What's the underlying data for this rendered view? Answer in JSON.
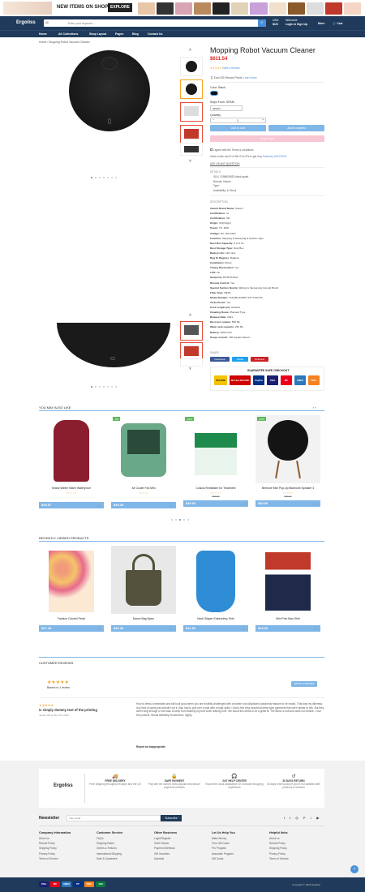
{
  "banner": {
    "headline": "NEW ITEMS ON SHOP",
    "cta": "EXPLORE"
  },
  "header": {
    "logo": "Ergoliss",
    "search_category": "All",
    "search_placeholder": "Enter your keyword ...",
    "currency_label": "USD",
    "currency_value": "$US",
    "account_top": "Welcome",
    "account_label": "Login & Sign Up",
    "more_label": "More",
    "cart_label": "Cart"
  },
  "nav": [
    "Home",
    "All Collections",
    "Shop Layout",
    "Pages",
    "Blog",
    "Contact Us"
  ],
  "breadcrumb": [
    "Home",
    "Mopping Robot Vacuum Cleaner"
  ],
  "product": {
    "title": "Mopping Robot Vacuum Cleaner",
    "price": "$611.54",
    "reviews_link": "Write a Review",
    "reward": "Earn 305 Reward Points.",
    "learn_more": "Learn More.",
    "color_label": "Color: Black",
    "ships_label": "Ships From: SPAIN",
    "ships_value": "SPAIN",
    "qty_label": "Quantity",
    "qty_value": "1",
    "add_to_cart": "Add to cart",
    "add_wishlist": "Add to wishlist",
    "buy_now": "Buy it now",
    "terms_text": "I agree with the Terms & conditions",
    "order_note": "Order in the next 3 d 00h 07m 37s to get it by",
    "order_date": "Saturday 16/07/2022",
    "question": "ASK US ANY QUESTION",
    "details_title": "DETAILS",
    "details": [
      "SKU: 3158604633-black-spain",
      "Brands: Xiaomi",
      "Type:",
      "Availability: In Stock"
    ],
    "desc_title": "DESCRIPTION",
    "specs": [
      [
        "Xiaomi Brand Name:",
        "Xiaomi"
      ],
      [
        "Certification:",
        "ce"
      ],
      [
        "Certification:",
        "CE"
      ],
      [
        "Origin:",
        "CN(Origin)"
      ],
      [
        "Power:",
        "Hz: 40W"
      ],
      [
        "Voltage:",
        "DC 100-240V"
      ],
      [
        "Function:",
        "Mopping & Sweeping & Suction Type"
      ],
      [
        "Dust Box Capacity:",
        "0.2~0.5 L"
      ],
      [
        "Dust Storage Type:",
        "Dust Box"
      ],
      [
        "Battery Life:",
        "120 mins"
      ],
      [
        "Bag Or Bagless:",
        "Bagless"
      ],
      [
        "Installation:",
        "Robot"
      ],
      [
        "Timing Reservation:",
        "Yes"
      ],
      [
        "LCD:",
        "No"
      ],
      [
        "Size(mm):",
        "35*35*8.45cm"
      ],
      [
        "Remote Control:",
        "Yes"
      ],
      [
        "Special Suction Nozzle:",
        "Wiping & Vacuuming Ground Brush"
      ],
      [
        "Filter Type:",
        "HEPA"
      ],
      [
        "Model Number:",
        "XIAOMI ROBOT STYTJ02YM"
      ],
      [
        "Turbo Brush:",
        "Yes"
      ],
      [
        "Cord Length (m):",
        "wireless"
      ],
      [
        "Cleaning Route:",
        "Planned Type"
      ],
      [
        "Release Date:",
        "2021"
      ],
      [
        "Dust box volume:",
        "550 ML"
      ],
      [
        "Water tank capacity:",
        "280 ML"
      ],
      [
        "Battery:",
        "3200 mAh"
      ],
      [
        "Scope of work:",
        "150 Square Meters"
      ]
    ],
    "share_title": "SHARE",
    "share": [
      "Facebook",
      "Twitter",
      "Pinterest"
    ],
    "guarantee": "GUARANTEE SAFE CHECKOUT",
    "pay_logos": [
      "SECURE",
      "McAfee SECURE",
      "PayPal",
      "VISA",
      "MC",
      "AMEX",
      "DISC"
    ]
  },
  "also_like": {
    "title": "YOU MAY ALSO LIKE",
    "items": [
      {
        "name": "Brand Winter Warm Waterproof",
        "price": "$40.57",
        "old": ""
      },
      {
        "name": "Air Cooler Fan Mini",
        "price": "$49.29",
        "old": "",
        "badge": "-6%"
      },
      {
        "name": "Cosiclo Revitalizer for Treatment",
        "price": "$40.00",
        "old": "$50.00",
        "badge": "-20%"
      },
      {
        "name": "Bremore Mini Pop-Up Bluetooth Speaker 4",
        "price": "$40.00",
        "old": "$50.00",
        "badge": "-20%"
      }
    ]
  },
  "recent": {
    "title": "RECENTLY VIEWED PRODUCTS",
    "items": [
      {
        "name": "Fashion Colorful Floral",
        "price": "$27.18"
      },
      {
        "name": "Dance Bag Nylon",
        "price": "$30.20"
      },
      {
        "name": "Neck Slipper Embroidery Shirt",
        "price": "$31.52"
      },
      {
        "name": "Mini Polo Man Shirt",
        "price": "$19.09"
      }
    ]
  },
  "reviews": {
    "title": "CUSTOMER REVIEWS",
    "based": "Based on 1 review",
    "write": "WRITE A REVIEW",
    "review_title": "is simply dummy text of the printing",
    "review_author": "Jeneth Hill on Nov 01, 2021",
    "review_body": "How to dress comfortably and still look good when you are mobility challenged with a broken foot (displaced calcaneus fracture to be exact). That was my dilemma. Any kind of pants just wouldn't cut it. Also had to pull over a cast with a huge splint. I had a few long tunic/midi-dress type garments that were similar to this. But they aren't long enough or the back to keep from flashing my butt when leaning over. We found this dress to be a great fit. The fabric is soft and does not wrinkle. I love the pockets. Would definitely recommend, highly.",
    "report": "Report as Inappropriate"
  },
  "features": {
    "logo": "Ergoliss",
    "items": [
      {
        "title": "FREE DELIVERY",
        "text": "Free shipping throughout Europe and the US"
      },
      {
        "title": "SAFE PAYMENT",
        "text": "Pay with the world's most popular and secure payment methods"
      },
      {
        "title": "24/7 HELP CENTER",
        "text": "Round the clock assistance for a smooth shopping experience"
      },
      {
        "title": "30 DAYS RETURN",
        "text": "30 days return policy if you're not satisfied with products & services"
      }
    ]
  },
  "newsletter": {
    "label": "Newsletter",
    "placeholder": "Your email",
    "button": "Subscribe"
  },
  "footer_cols": [
    {
      "title": "Company Information",
      "links": [
        "About us",
        "Refund Policy",
        "Shipping Policy",
        "Privacy Policy",
        "Terms of Service"
      ]
    },
    {
      "title": "Customer Service",
      "links": [
        "FAQ's",
        "Shipping Rates",
        "Orders & Returns",
        "International Shipping",
        "Safe & Guarantee"
      ]
    },
    {
      "title": "Other Business",
      "links": [
        "Login/Register",
        "Order Status",
        "Payment Methods",
        "Gift Vouchers",
        "Specials"
      ]
    },
    {
      "title": "Let Us Help You",
      "links": [
        "Make Money",
        "Free Gift Cards",
        "Pro Program",
        "Associate Program",
        "Gift Cards"
      ]
    },
    {
      "title": "Helpful links",
      "links": [
        "About us",
        "Refund Policy",
        "Shipping Policy",
        "Privacy Policy",
        "Terms of Service"
      ]
    }
  ],
  "copyright": "Copyright © 2021 Ergoliss"
}
